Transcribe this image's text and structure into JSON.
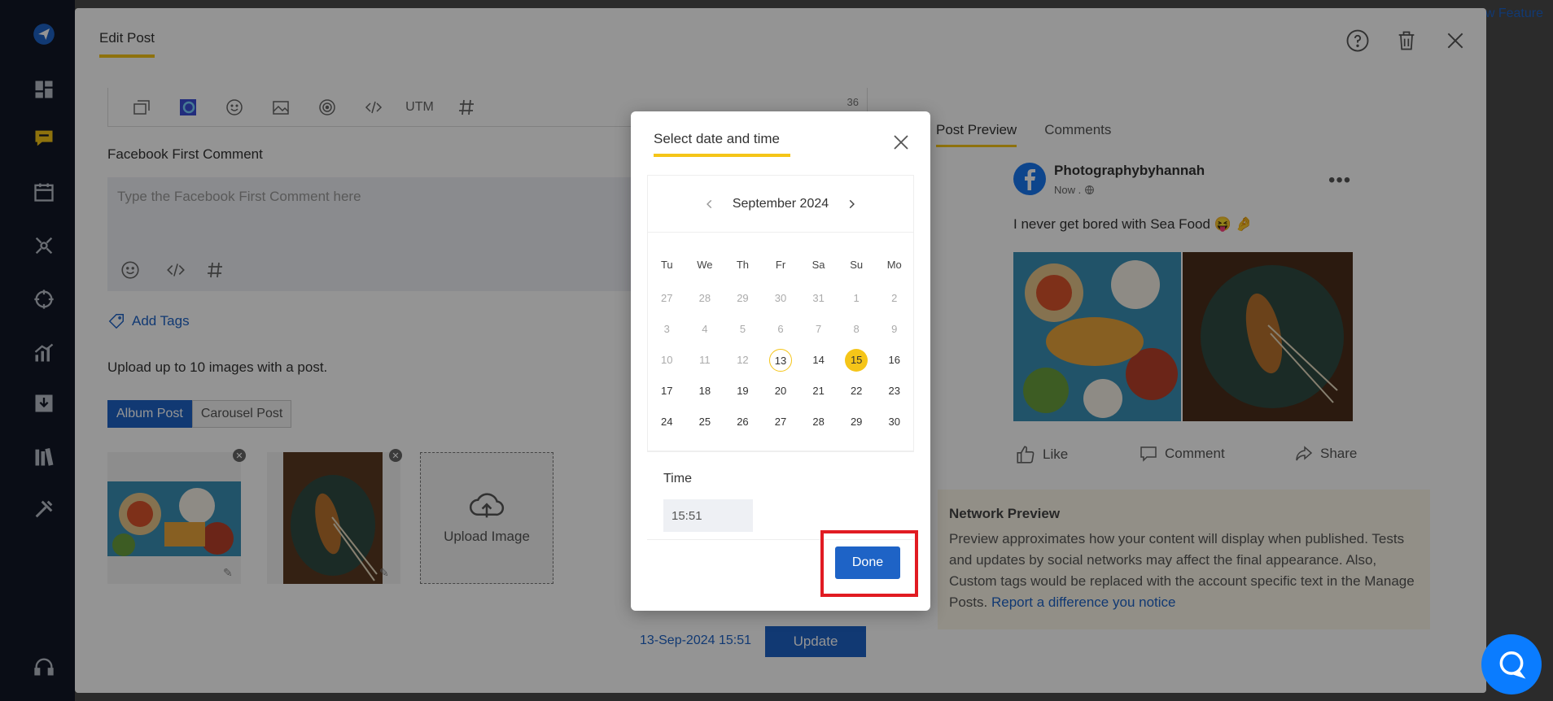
{
  "background": {
    "feature_link": "w Feature"
  },
  "sidebar": {
    "items": [
      {
        "icon": "send-icon"
      },
      {
        "icon": "dashboard-icon"
      },
      {
        "icon": "messages-icon"
      },
      {
        "icon": "calendar-icon"
      },
      {
        "icon": "network-icon"
      },
      {
        "icon": "target-icon"
      },
      {
        "icon": "analytics-icon"
      },
      {
        "icon": "download-icon"
      },
      {
        "icon": "library-icon"
      },
      {
        "icon": "tools-icon"
      },
      {
        "icon": "headset-icon"
      }
    ]
  },
  "edit_post": {
    "title": "Edit Post",
    "toolbar_count": "36",
    "toolbar_utm": "UTM",
    "first_comment_label": "Facebook First Comment",
    "first_comment_placeholder": "Type the Facebook First Comment here",
    "add_tags": "Add Tags",
    "upload_hint": "Upload up to 10 images with a post.",
    "post_types": [
      "Album Post",
      "Carousel Post"
    ],
    "upload_image": "Upload Image",
    "schedule_date": "13-Sep-2024 15:51",
    "update_label": "Update"
  },
  "preview": {
    "tabs": [
      "Post Preview",
      "Comments"
    ],
    "page_name": "Photographybyhannah",
    "meta": "Now .",
    "post_text": "I never get bored with Sea Food 😝 🤌",
    "actions": [
      "Like",
      "Comment",
      "Share"
    ],
    "network_title": "Network Preview",
    "network_body": "Preview approximates how your content will display when published. Tests and updates by social networks may affect the final appearance. Also, Custom tags would be replaced with the account specific text in the Manage Posts.",
    "network_link": "Report a difference you notice"
  },
  "date_picker": {
    "title": "Select date and time",
    "month": "September 2024",
    "weekdays": [
      "Tu",
      "We",
      "Th",
      "Fr",
      "Sa",
      "Su",
      "Mo"
    ],
    "weeks": [
      [
        {
          "d": "27",
          "m": true
        },
        {
          "d": "28",
          "m": true
        },
        {
          "d": "29",
          "m": true
        },
        {
          "d": "30",
          "m": true
        },
        {
          "d": "31",
          "m": true
        },
        {
          "d": "1",
          "m": true
        },
        {
          "d": "2",
          "m": true
        }
      ],
      [
        {
          "d": "3",
          "m": true
        },
        {
          "d": "4",
          "m": true
        },
        {
          "d": "5",
          "m": true
        },
        {
          "d": "6",
          "m": true
        },
        {
          "d": "7",
          "m": true
        },
        {
          "d": "8",
          "m": true
        },
        {
          "d": "9",
          "m": true
        }
      ],
      [
        {
          "d": "10",
          "m": true
        },
        {
          "d": "11",
          "m": true
        },
        {
          "d": "12",
          "m": true
        },
        {
          "d": "13",
          "today": true
        },
        {
          "d": "14"
        },
        {
          "d": "15",
          "selected": true
        },
        {
          "d": "16"
        }
      ],
      [
        {
          "d": "17"
        },
        {
          "d": "18"
        },
        {
          "d": "19"
        },
        {
          "d": "20"
        },
        {
          "d": "21"
        },
        {
          "d": "22"
        },
        {
          "d": "23"
        }
      ],
      [
        {
          "d": "24"
        },
        {
          "d": "25"
        },
        {
          "d": "26"
        },
        {
          "d": "27"
        },
        {
          "d": "28"
        },
        {
          "d": "29"
        },
        {
          "d": "30"
        }
      ]
    ],
    "time_label": "Time",
    "time_value": "15:51",
    "done_label": "Done"
  },
  "colors": {
    "accent_yellow": "#f5c518",
    "primary_blue": "#1e63c6",
    "highlight_red": "#e11b22"
  }
}
